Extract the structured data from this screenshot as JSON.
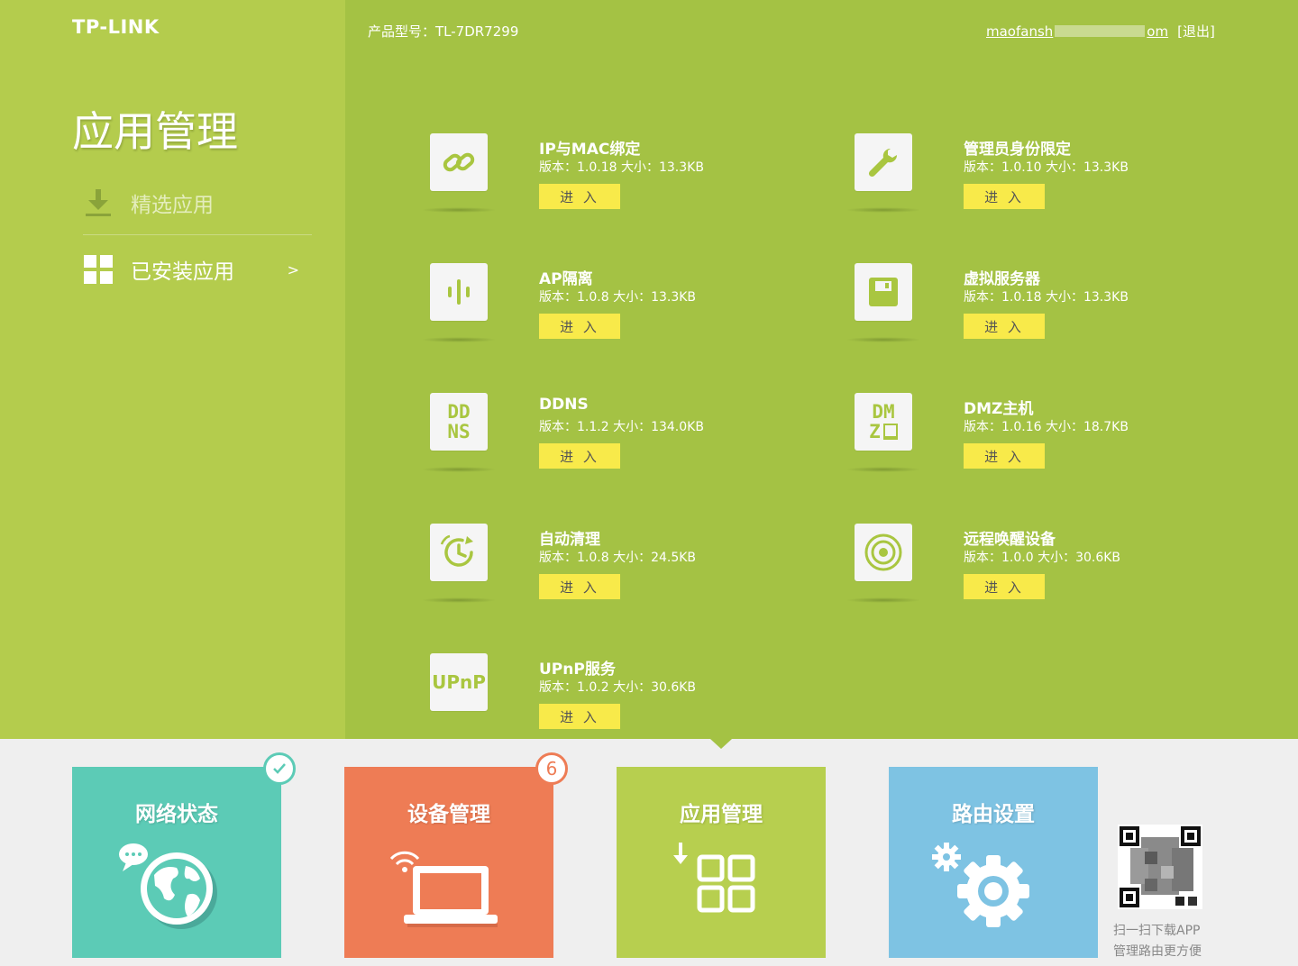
{
  "brand": {
    "logo": "TP-LINK"
  },
  "page": {
    "title": "应用管理"
  },
  "sidebar": {
    "featured_label": "精选应用",
    "installed_label": "已安装应用",
    "installed_arrow": ">"
  },
  "header": {
    "model": "产品型号：TL-7DR7299",
    "user_start": "maofansh",
    "user_end": "om",
    "logout": "[退出]"
  },
  "enter_label": "进 入",
  "apps": [
    {
      "name": "IP与MAC绑定",
      "meta": "版本：1.0.18 大小：13.3KB",
      "icon": "link-icon"
    },
    {
      "name": "管理员身份限定",
      "meta": "版本：1.0.10 大小：13.3KB",
      "icon": "wrench-icon"
    },
    {
      "name": "AP隔离",
      "meta": "版本：1.0.8 大小：13.3KB",
      "icon": "ap-isolation-icon"
    },
    {
      "name": "虚拟服务器",
      "meta": "版本：1.0.18 大小：13.3KB",
      "icon": "floppy-icon"
    },
    {
      "name": "DDNS",
      "meta": "版本：1.1.2 大小：134.0KB",
      "icon": "ddns-icon",
      "icon_line1": "DD",
      "icon_line2": "NS"
    },
    {
      "name": "DMZ主机",
      "meta": "版本：1.0.16 大小：18.7KB",
      "icon": "dmz-icon",
      "icon_line1": "DM",
      "icon_line2": "Z"
    },
    {
      "name": "自动清理",
      "meta": "版本：1.0.8 大小：24.5KB",
      "icon": "auto-clean-icon"
    },
    {
      "name": "远程唤醒设备",
      "meta": "版本：1.0.0 大小：30.6KB",
      "icon": "wake-target-icon"
    },
    {
      "name": "UPnP服务",
      "meta": "版本：1.0.2 大小：30.6KB",
      "icon": "upnp-icon",
      "icon_text": "UPnP"
    }
  ],
  "tiles": [
    {
      "label": "网络状态",
      "icon": "globe-icon",
      "badge": "check-icon"
    },
    {
      "label": "设备管理",
      "icon": "laptop-icon",
      "badge_count": "6"
    },
    {
      "label": "应用管理",
      "icon": "apps-grid-icon"
    },
    {
      "label": "路由设置",
      "icon": "gear-icon"
    }
  ],
  "qr": {
    "line1": "扫一扫下载APP",
    "line2": "管理路由更方便"
  },
  "colors": {
    "sidebar": "#b4cc4d",
    "main": "#a4c244",
    "enter_button": "#f8ea4a",
    "tile_network": "#5ccbb6",
    "tile_device": "#ee7c55",
    "tile_app": "#b7cf4f",
    "tile_route": "#7ec3e3"
  }
}
